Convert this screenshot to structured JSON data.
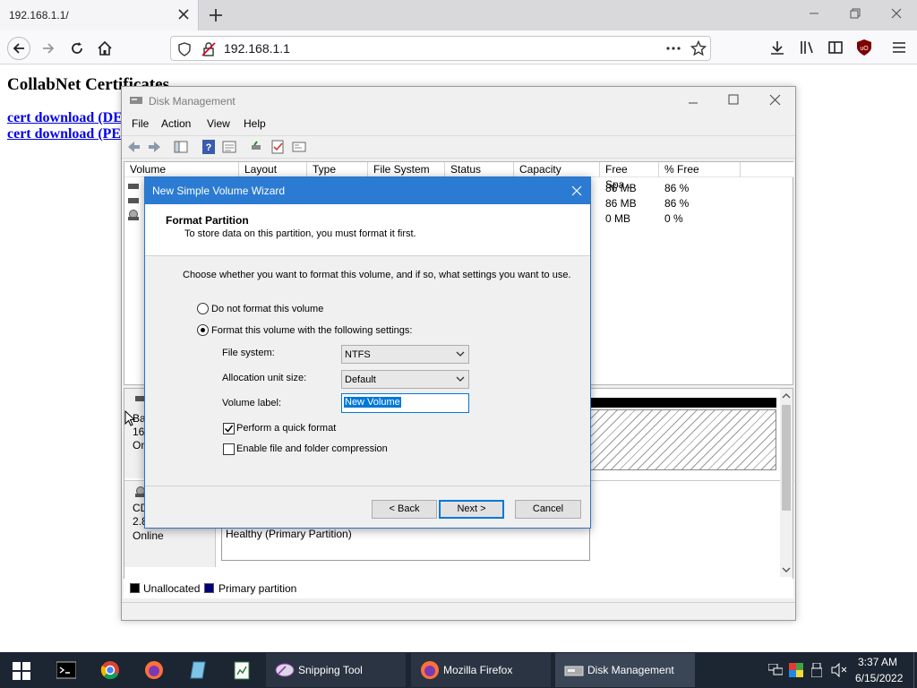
{
  "browser": {
    "tab_title": "192.168.1.1/",
    "url": "192.168.1.1"
  },
  "page": {
    "heading": "CollabNet Certificates",
    "links": [
      "cert download (DE",
      "cert download (PE"
    ]
  },
  "disk_management": {
    "title": "Disk Management",
    "menu": [
      "File",
      "Action",
      "View",
      "Help"
    ],
    "columns": [
      "Volume",
      "Layout",
      "Type",
      "File System",
      "Status",
      "Capacity",
      "Free Spa...",
      "% Free"
    ],
    "rows": [
      {
        "free": "86 MB",
        "pct": "86 %"
      },
      {
        "free": "86 MB",
        "pct": "86 %"
      },
      {
        "free": "0 MB",
        "pct": "0 %"
      }
    ],
    "disk0": {
      "line1": "Ba",
      "line2": "16",
      "line3": "On"
    },
    "cdrom": {
      "name": "CD",
      "size": "2.8",
      "status": "Online"
    },
    "partition_status": "Healthy (Primary Partition)",
    "legend": {
      "unallocated": "Unallocated",
      "primary": "Primary partition"
    },
    "colors": {
      "unallocated": "#000000",
      "primary": "#00007f"
    }
  },
  "wizard": {
    "title": "New Simple Volume Wizard",
    "header_title": "Format Partition",
    "header_subtitle": "To store data on this partition, you must format it first.",
    "instruction": "Choose whether you want to format this volume, and if so, what settings you want to use.",
    "option_no_format": "Do not format this volume",
    "option_format": "Format this volume with the following settings:",
    "file_system_label": "File system:",
    "file_system_value": "NTFS",
    "allocation_label": "Allocation unit size:",
    "allocation_value": "Default",
    "volume_label_label": "Volume label:",
    "volume_label_value": "New Volume",
    "quick_format": "Perform a quick format",
    "compression": "Enable file and folder compression",
    "back_button": "< Back",
    "next_button": "Next >",
    "cancel_button": "Cancel"
  },
  "taskbar": {
    "apps": [
      {
        "label": "Snipping Tool"
      },
      {
        "label": "Mozilla Firefox"
      },
      {
        "label": "Disk Management"
      }
    ],
    "time": "3:37 AM",
    "date": "6/15/2022"
  }
}
